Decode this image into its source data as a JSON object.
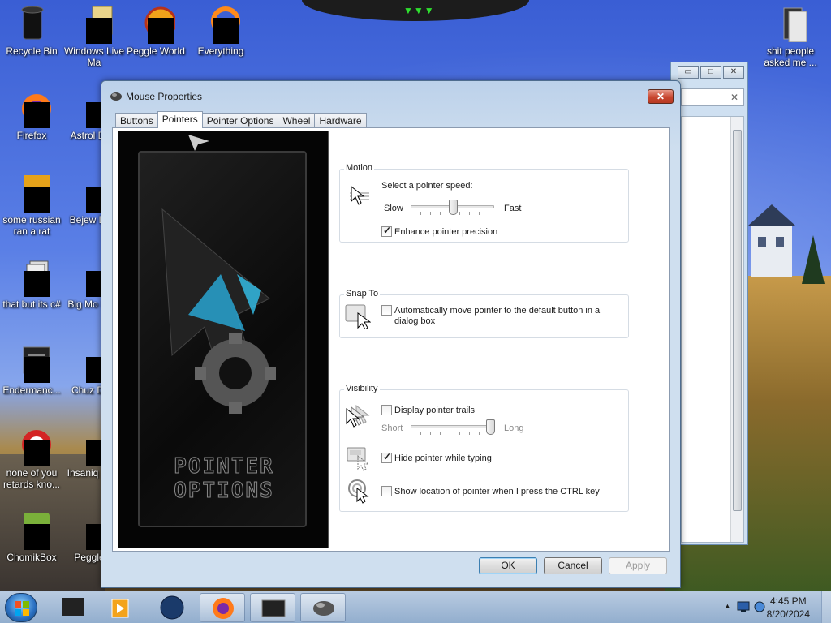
{
  "desktop": {
    "icons": [
      {
        "label": "Recycle Bin",
        "icon": "recycle-bin-icon"
      },
      {
        "label": "Windows Live Ma",
        "icon": "windows-live-icon"
      },
      {
        "label": "Peggle World",
        "icon": "peggle-icon"
      },
      {
        "label": "Everything",
        "icon": "everything-icon"
      },
      {
        "label": "shit people asked me ...",
        "icon": "folder-icon"
      },
      {
        "label": "Firefox",
        "icon": "firefox-icon"
      },
      {
        "label": "Astrol Delu",
        "icon": "app-icon"
      },
      {
        "label": "some russian ran a rat",
        "icon": "app-icon"
      },
      {
        "label": "Bejew Delu",
        "icon": "app-icon"
      },
      {
        "label": "that but its c#",
        "icon": "app-icon"
      },
      {
        "label": "Big Mo Delu",
        "icon": "app-icon"
      },
      {
        "label": "Endermanc...",
        "icon": "app-icon"
      },
      {
        "label": "Chuz Delu",
        "icon": "app-icon"
      },
      {
        "label": "none of you retards kno...",
        "icon": "app-icon"
      },
      {
        "label": "Insaniq Delu",
        "icon": "app-icon"
      },
      {
        "label": "ChomikBox",
        "icon": "chomikbox-icon"
      },
      {
        "label": "Peggle D",
        "icon": "app-icon"
      }
    ]
  },
  "dialog": {
    "title": "Mouse Properties",
    "close_glyph": "✕",
    "tabs": [
      "Buttons",
      "Pointers",
      "Pointer Options",
      "Wheel",
      "Hardware"
    ],
    "active_tab": "Pointers",
    "art_text": "POINTER OPTIONS",
    "motion": {
      "legend": "Motion",
      "speed_label": "Select a pointer speed:",
      "slow": "Slow",
      "fast": "Fast",
      "speed_value": 0.5,
      "precision_label": "Enhance pointer precision",
      "precision_checked": true
    },
    "snap": {
      "legend": "Snap To",
      "label": "Automatically move pointer to the default button in a dialog box",
      "checked": false
    },
    "visibility": {
      "legend": "Visibility",
      "trails_label": "Display pointer trails",
      "trails_checked": false,
      "short": "Short",
      "long": "Long",
      "trails_value": 1.0,
      "hide_label": "Hide pointer while typing",
      "hide_checked": true,
      "ctrl_label": "Show location of pointer when I press the CTRL key",
      "ctrl_checked": false
    },
    "buttons": {
      "ok": "OK",
      "cancel": "Cancel",
      "apply": "Apply"
    }
  },
  "background_window": {
    "minimize": "▭",
    "maximize": "□",
    "close": "✕",
    "search_clear": "✕"
  },
  "taskbar": {
    "time": "4:45 PM",
    "date": "8/20/2024",
    "items": [
      "app-icon",
      "media-player-icon",
      "globe-icon",
      "firefox-icon",
      "terminal-icon",
      "mouse-icon"
    ]
  }
}
